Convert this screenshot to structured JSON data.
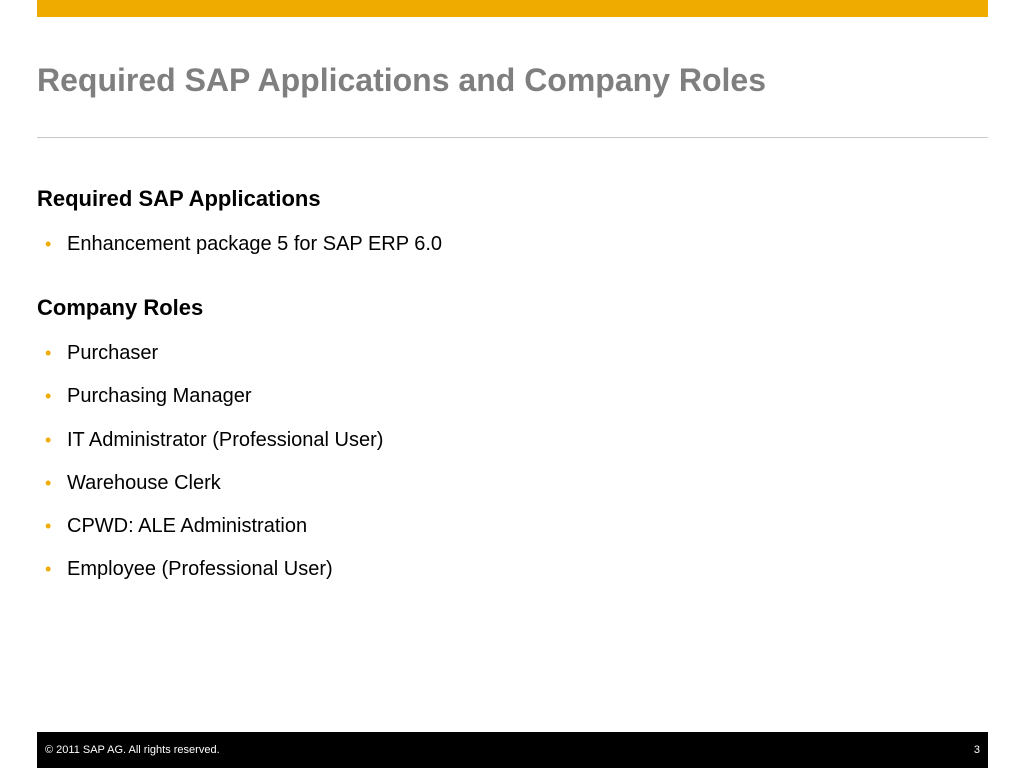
{
  "theme": {
    "accent_color": "#f0ab00",
    "title_color": "#7f7f7f",
    "footer_color": "#000000",
    "bullet_icon": "bullet-dot-icon"
  },
  "slide": {
    "title": "Required SAP Applications and Company Roles",
    "sections": [
      {
        "heading": "Required SAP Applications",
        "items": [
          "Enhancement package 5 for SAP ERP 6.0"
        ]
      },
      {
        "heading": "Company Roles",
        "items": [
          "Purchaser",
          "Purchasing Manager",
          "IT Administrator (Professional User)",
          "Warehouse Clerk",
          "CPWD: ALE Administration",
          "Employee (Professional User)"
        ]
      }
    ]
  },
  "footer": {
    "copyright": "©  2011 SAP AG. All rights reserved.",
    "page_number": "3"
  }
}
